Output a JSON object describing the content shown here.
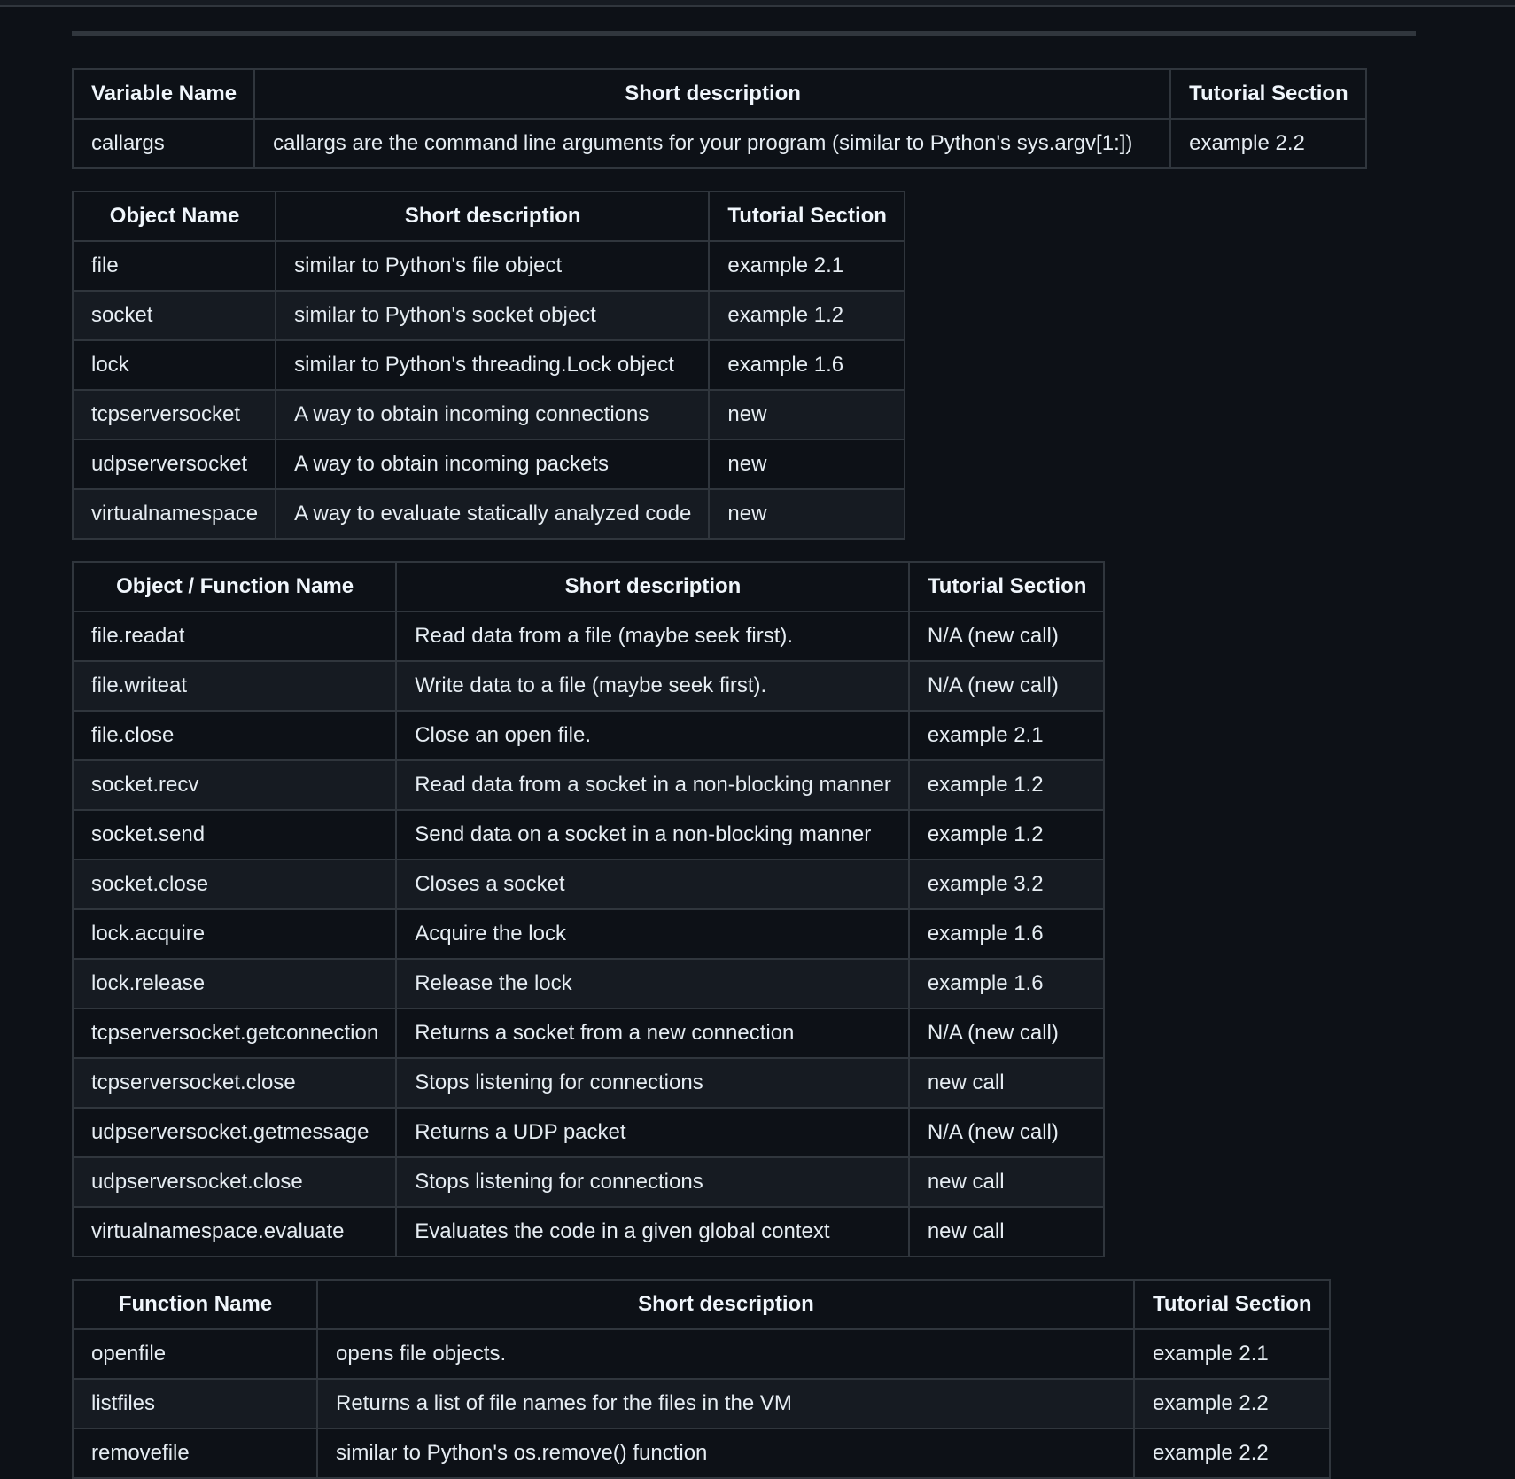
{
  "tables": [
    {
      "headers": [
        "Variable Name",
        "Short description",
        "Tutorial Section"
      ],
      "rows": [
        [
          "callargs",
          "callargs are the command line arguments for your program (similar to Python's sys.argv[1:])",
          "example 2.2"
        ]
      ]
    },
    {
      "headers": [
        "Object Name",
        "Short description",
        "Tutorial Section"
      ],
      "rows": [
        [
          "file",
          "similar to Python's file object",
          "example 2.1"
        ],
        [
          "socket",
          "similar to Python's socket object",
          "example 1.2"
        ],
        [
          "lock",
          "similar to Python's threading.Lock object",
          "example 1.6"
        ],
        [
          "tcpserversocket",
          "A way to obtain incoming connections",
          "new"
        ],
        [
          "udpserversocket",
          "A way to obtain incoming packets",
          "new"
        ],
        [
          "virtualnamespace",
          "A way to evaluate statically analyzed code",
          "new"
        ]
      ]
    },
    {
      "headers": [
        "Object / Function Name",
        "Short description",
        "Tutorial Section"
      ],
      "rows": [
        [
          "file.readat",
          "Read data from a file (maybe seek first).",
          "N/A (new call)"
        ],
        [
          "file.writeat",
          "Write data to a file (maybe seek first).",
          "N/A (new call)"
        ],
        [
          "file.close",
          "Close an open file.",
          "example 2.1"
        ],
        [
          "socket.recv",
          "Read data from a socket in a non-blocking manner",
          "example 1.2"
        ],
        [
          "socket.send",
          "Send data on a socket in a non-blocking manner",
          "example 1.2"
        ],
        [
          "socket.close",
          "Closes a socket",
          "example 3.2"
        ],
        [
          "lock.acquire",
          "Acquire the lock",
          "example 1.6"
        ],
        [
          "lock.release",
          "Release the lock",
          "example 1.6"
        ],
        [
          "tcpserversocket.getconnection",
          "Returns a socket from a new connection",
          "N/A (new call)"
        ],
        [
          "tcpserversocket.close",
          "Stops listening for connections",
          "new call"
        ],
        [
          "udpserversocket.getmessage",
          "Returns a UDP packet",
          "N/A (new call)"
        ],
        [
          "udpserversocket.close",
          "Stops listening for connections",
          "new call"
        ],
        [
          "virtualnamespace.evaluate",
          "Evaluates the code in a given global context",
          "new call"
        ]
      ]
    },
    {
      "headers": [
        "Function Name",
        "Short description",
        "Tutorial Section"
      ],
      "rows": [
        [
          "openfile",
          "opens file objects.",
          "example 2.1"
        ],
        [
          "listfiles",
          "Returns a list of file names for the files in the VM",
          "example 2.2"
        ],
        [
          "removefile",
          "similar to Python's os.remove() function",
          "example 2.2"
        ]
      ]
    }
  ]
}
